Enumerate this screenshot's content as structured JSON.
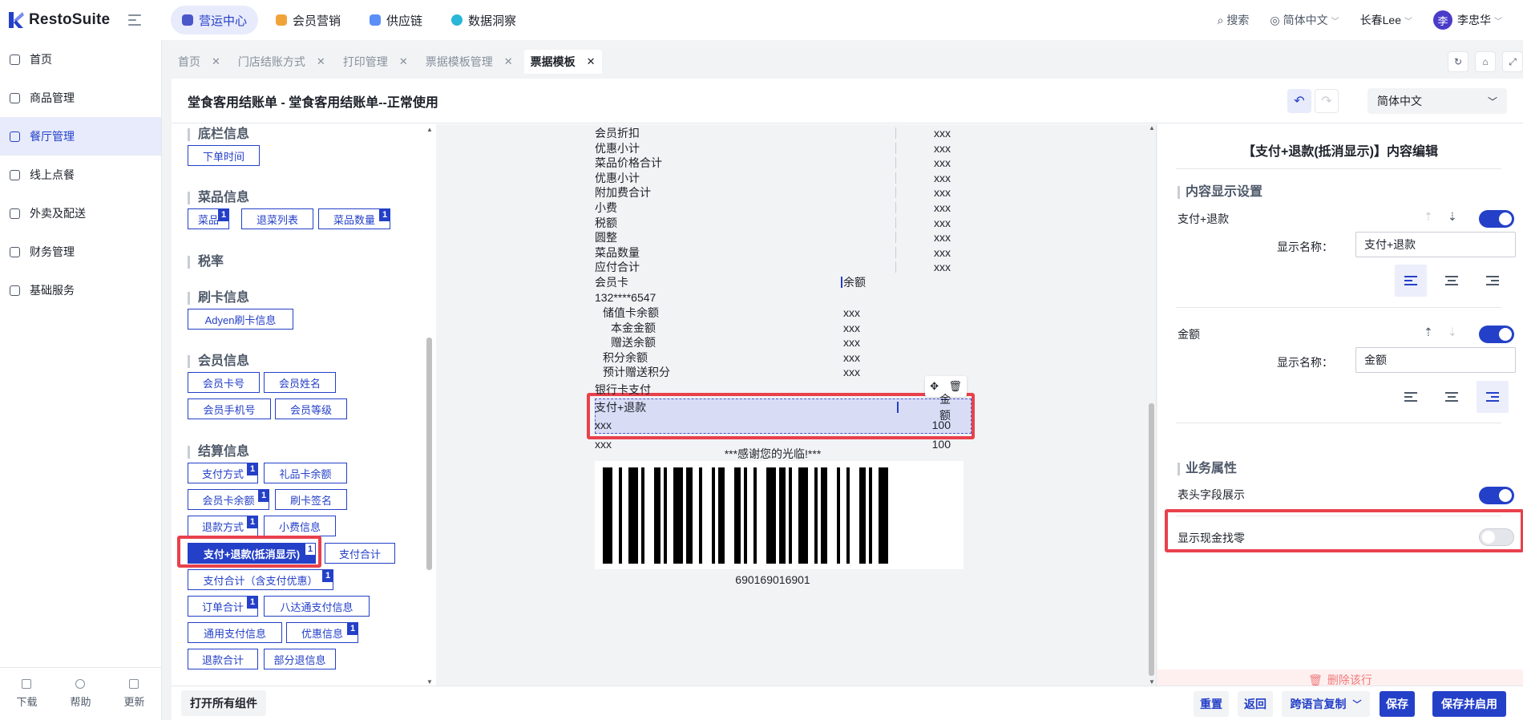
{
  "app": {
    "brand": "RestoSuite"
  },
  "topnav": [
    {
      "label": "营运中心",
      "color": "#4a57c9",
      "active": true
    },
    {
      "label": "会员营销",
      "color": "#f1a33a"
    },
    {
      "label": "供应链",
      "color": "#5b8ef7"
    },
    {
      "label": "数据洞察",
      "color": "#29b6d8"
    }
  ],
  "top_right": {
    "search": "搜索",
    "language": "简体中文",
    "store": "长春Lee",
    "user_initial": "李",
    "user_name": "李忠华"
  },
  "sidebar": {
    "items": [
      {
        "label": "首页"
      },
      {
        "label": "商品管理"
      },
      {
        "label": "餐厅管理",
        "active": true
      },
      {
        "label": "线上点餐"
      },
      {
        "label": "外卖及配送"
      },
      {
        "label": "财务管理"
      },
      {
        "label": "基础服务"
      }
    ],
    "bottom": [
      {
        "label": "下载"
      },
      {
        "label": "帮助"
      },
      {
        "label": "更新"
      }
    ]
  },
  "tabs": [
    {
      "label": "首页"
    },
    {
      "label": "门店结账方式"
    },
    {
      "label": "打印管理"
    },
    {
      "label": "票据模板管理"
    },
    {
      "label": "票据模板",
      "active": true
    }
  ],
  "editor": {
    "title": "堂食客用结账单 - 堂食客用结账单--正常使用",
    "language": "简体中文"
  },
  "components": {
    "sections": [
      {
        "title": "底栏信息",
        "chips": [
          {
            "label": "下单时间"
          }
        ]
      },
      {
        "title": "菜品信息",
        "chips": [
          {
            "label": "菜品",
            "badge": "1"
          },
          {
            "label": "退菜列表"
          },
          {
            "label": "菜品数量",
            "badge": "1"
          }
        ]
      },
      {
        "title": "税率",
        "chips": []
      },
      {
        "title": "刷卡信息",
        "chips": [
          {
            "label": "Adyen刷卡信息"
          }
        ]
      },
      {
        "title": "会员信息",
        "chips": [
          {
            "label": "会员卡号"
          },
          {
            "label": "会员姓名"
          },
          {
            "label": "会员手机号"
          },
          {
            "label": "会员等级"
          }
        ]
      },
      {
        "title": "结算信息",
        "chips": [
          {
            "label": "支付方式",
            "badge": "1"
          },
          {
            "label": "礼品卡余额"
          },
          {
            "label": "会员卡余额",
            "badge": "1"
          },
          {
            "label": "刷卡签名"
          },
          {
            "label": "退款方式",
            "badge": "1"
          },
          {
            "label": "小费信息"
          },
          {
            "label": "支付+退款(抵消显示)",
            "badge": "1",
            "selected": true
          },
          {
            "label": "支付合计"
          },
          {
            "label": "支付合计（含支付优惠）",
            "badge": "1"
          },
          {
            "label": "订单合计",
            "badge": "1"
          },
          {
            "label": "八达通支付信息"
          },
          {
            "label": "通用支付信息"
          },
          {
            "label": "优惠信息",
            "badge": "1"
          },
          {
            "label": "退款合计"
          },
          {
            "label": "部分退信息"
          }
        ]
      }
    ],
    "open_all": "打开所有组件"
  },
  "receipt": {
    "rows": [
      {
        "label": "会员折扣",
        "value": "xxx"
      },
      {
        "label": "优惠小计",
        "value": "xxx"
      },
      {
        "label": "菜品价格合计",
        "value": "xxx"
      },
      {
        "label": "优惠小计",
        "value": "xxx"
      },
      {
        "label": "附加费合计",
        "value": "xxx"
      },
      {
        "label": "小费",
        "value": "xxx"
      },
      {
        "label": "税额",
        "value": "xxx"
      },
      {
        "label": "圆整",
        "value": "xxx"
      },
      {
        "label": "菜品数量",
        "value": "xxx"
      },
      {
        "label": "应付合计",
        "value": "xxx"
      }
    ],
    "member_card": {
      "label": "会员卡",
      "col": "余额",
      "number": "132****6547"
    },
    "member_sub": [
      {
        "label": "储值卡余额",
        "value": "xxx"
      },
      {
        "label": "本金金额",
        "value": "xxx"
      },
      {
        "label": "赠送余额",
        "value": "xxx"
      },
      {
        "label": "积分余额",
        "value": "xxx"
      },
      {
        "label": "预计赠送积分",
        "value": "xxx"
      }
    ],
    "bank_card": "银行卡支付",
    "payment_block": {
      "label": "支付+退款",
      "col": "金额",
      "row_label": "xxx",
      "row_value": "100"
    },
    "extra_row": {
      "label": "xxx",
      "value": "100"
    },
    "thanks": "***感谢您的光临!***",
    "barcode": "690169016901"
  },
  "props": {
    "title": "【支付+退款(抵消显示)】内容编辑",
    "section_display": "内容显示设置",
    "field1": {
      "label": "支付+退款",
      "name_label": "显示名称：",
      "name_value": "支付+退款",
      "enabled": true,
      "align": "left"
    },
    "field2": {
      "label": "金额",
      "name_label": "显示名称：",
      "name_value": "金额",
      "enabled": true,
      "align": "right"
    },
    "section_business": "业务属性",
    "header_field_show": {
      "label": "表头字段展示",
      "enabled": true
    },
    "show_cash_change": {
      "label": "显示现金找零",
      "enabled": false
    },
    "delete_row": "删除该行"
  },
  "footer": {
    "reset": "重置",
    "back": "返回",
    "cross_copy": "跨语言复制",
    "save": "保存",
    "save_enable": "保存并启用"
  },
  "colors": {
    "accent": "#2440c8",
    "highlight": "#e8414c"
  }
}
